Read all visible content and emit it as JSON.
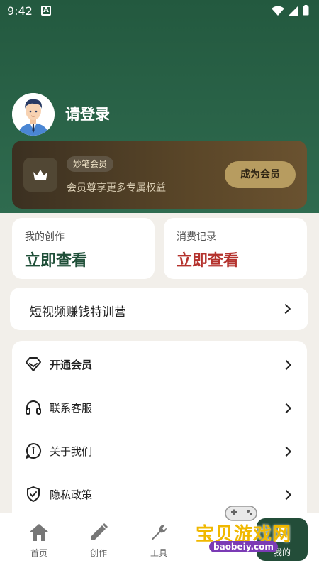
{
  "status_bar": {
    "time": "9:42",
    "notification_letter": "A"
  },
  "profile": {
    "login_text": "请登录"
  },
  "vip_card": {
    "badge": "妙笔会员",
    "description": "会员尊享更多专属权益",
    "button": "成为会员"
  },
  "my_creations": {
    "title": "我的创作",
    "action": "立即查看",
    "action_color": "#1f4f38"
  },
  "consumption": {
    "title": "消费记录",
    "action": "立即查看",
    "action_color": "#b4322d"
  },
  "camp": {
    "label": "短视频赚钱特训营"
  },
  "menu": {
    "items": [
      {
        "label": "开通会员",
        "icon": "diamond-icon"
      },
      {
        "label": "联系客服",
        "icon": "headset-icon"
      },
      {
        "label": "关于我们",
        "icon": "info-icon"
      },
      {
        "label": "隐私政策",
        "icon": "shield-icon"
      }
    ]
  },
  "tabbar": {
    "tabs": [
      {
        "label": "首页",
        "icon": "home-icon"
      },
      {
        "label": "创作",
        "icon": "pencil-icon"
      },
      {
        "label": "工具",
        "icon": "wrench-icon"
      },
      {
        "label": "我的",
        "icon": "user-icon"
      }
    ]
  },
  "watermark": {
    "text": "宝贝游戏网",
    "url": "baobeiy.com"
  },
  "colors": {
    "header_green": "#23593f",
    "vip_gold": "#b79c60",
    "background": "#f2efea"
  }
}
